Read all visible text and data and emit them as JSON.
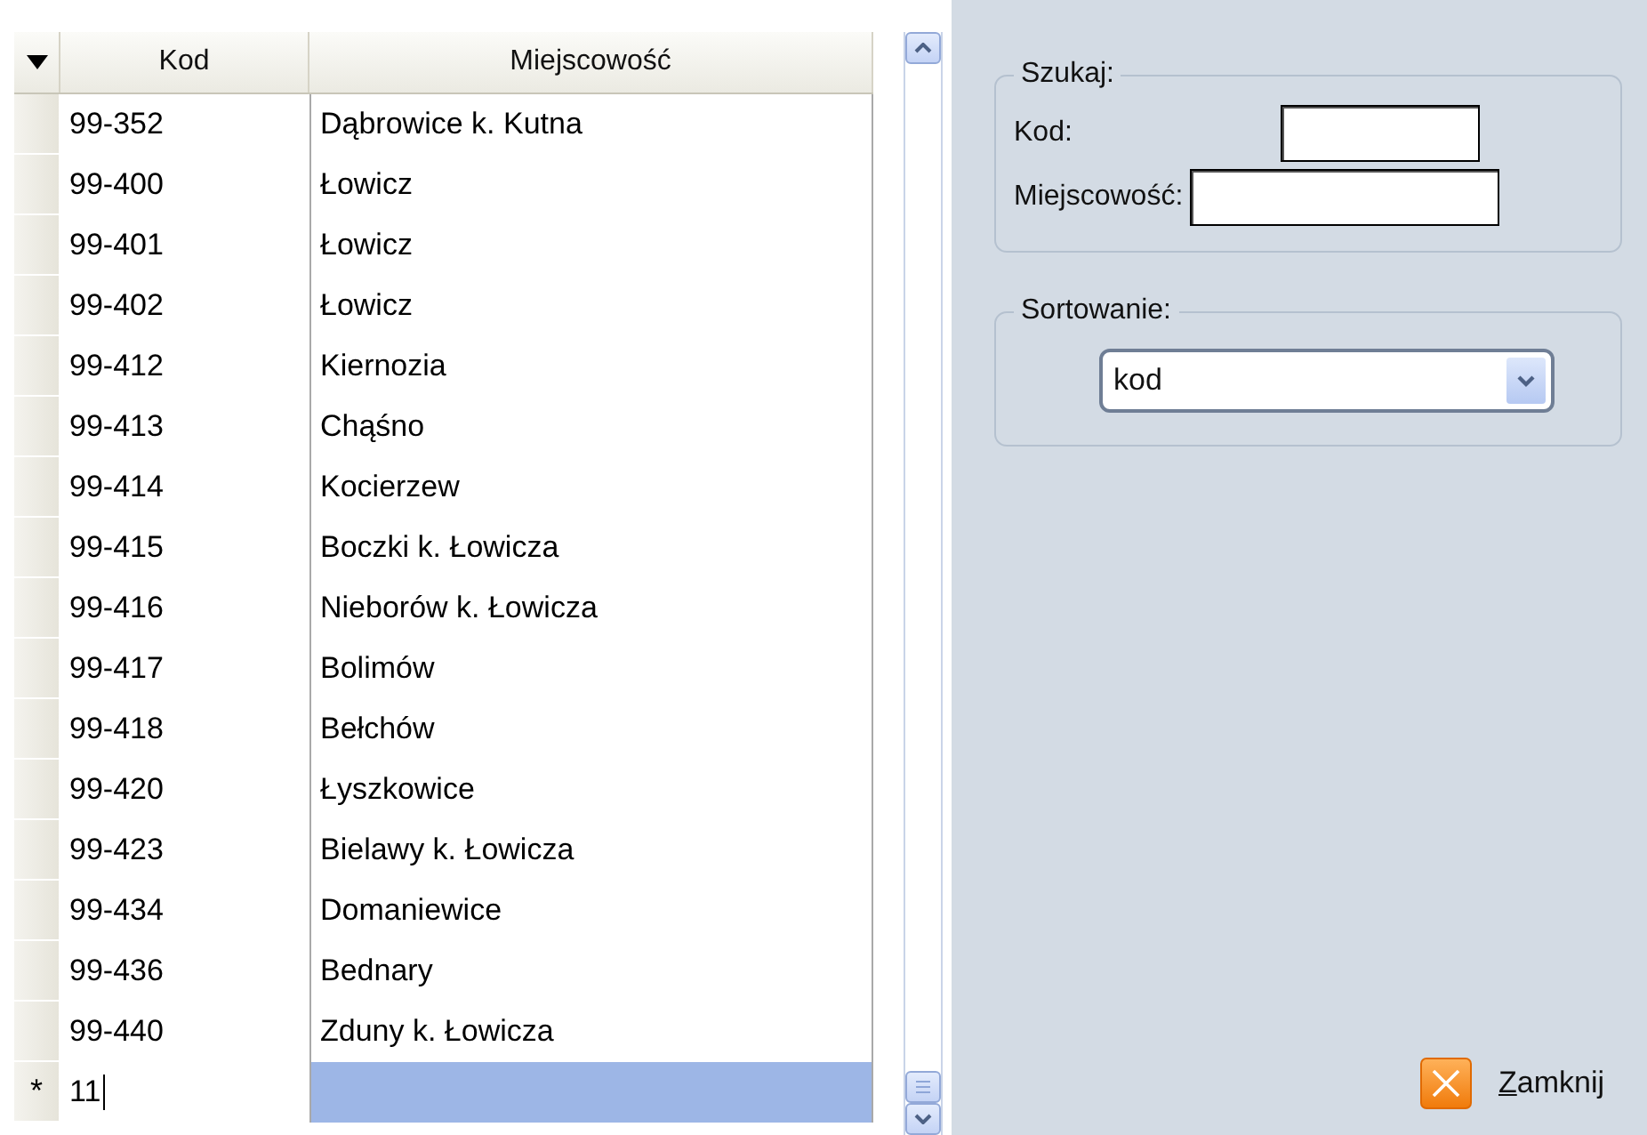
{
  "grid": {
    "columns": [
      {
        "label": "Kod"
      },
      {
        "label": "Miejscowość"
      }
    ],
    "rows": [
      {
        "kod": "99-352",
        "miejscowosc": "Dąbrowice k. Kutna"
      },
      {
        "kod": "99-400",
        "miejscowosc": "Łowicz"
      },
      {
        "kod": "99-401",
        "miejscowosc": "Łowicz"
      },
      {
        "kod": "99-402",
        "miejscowosc": "Łowicz"
      },
      {
        "kod": "99-412",
        "miejscowosc": "Kiernozia"
      },
      {
        "kod": "99-413",
        "miejscowosc": "Chąśno"
      },
      {
        "kod": "99-414",
        "miejscowosc": "Kocierzew"
      },
      {
        "kod": "99-415",
        "miejscowosc": "Boczki k. Łowicza"
      },
      {
        "kod": "99-416",
        "miejscowosc": "Nieborów k. Łowicza"
      },
      {
        "kod": "99-417",
        "miejscowosc": "Bolimów"
      },
      {
        "kod": "99-418",
        "miejscowosc": "Bełchów"
      },
      {
        "kod": "99-420",
        "miejscowosc": "Łyszkowice"
      },
      {
        "kod": "99-423",
        "miejscowosc": "Bielawy k. Łowicza"
      },
      {
        "kod": "99-434",
        "miejscowosc": "Domaniewice"
      },
      {
        "kod": "99-436",
        "miejscowosc": "Bednary"
      },
      {
        "kod": "99-440",
        "miejscowosc": "Zduny k. Łowicza"
      }
    ],
    "new_row": {
      "marker": "*",
      "kod": "11",
      "miejscowosc_selected": true
    }
  },
  "search": {
    "title": "Szukaj:",
    "fields": [
      {
        "label": "Kod:"
      },
      {
        "label": "Miejscowość:"
      }
    ]
  },
  "sorting": {
    "title": "Sortowanie:",
    "value": "kod"
  },
  "close_button": {
    "label": "Zamknij",
    "mnemonic_underlined": true
  }
}
